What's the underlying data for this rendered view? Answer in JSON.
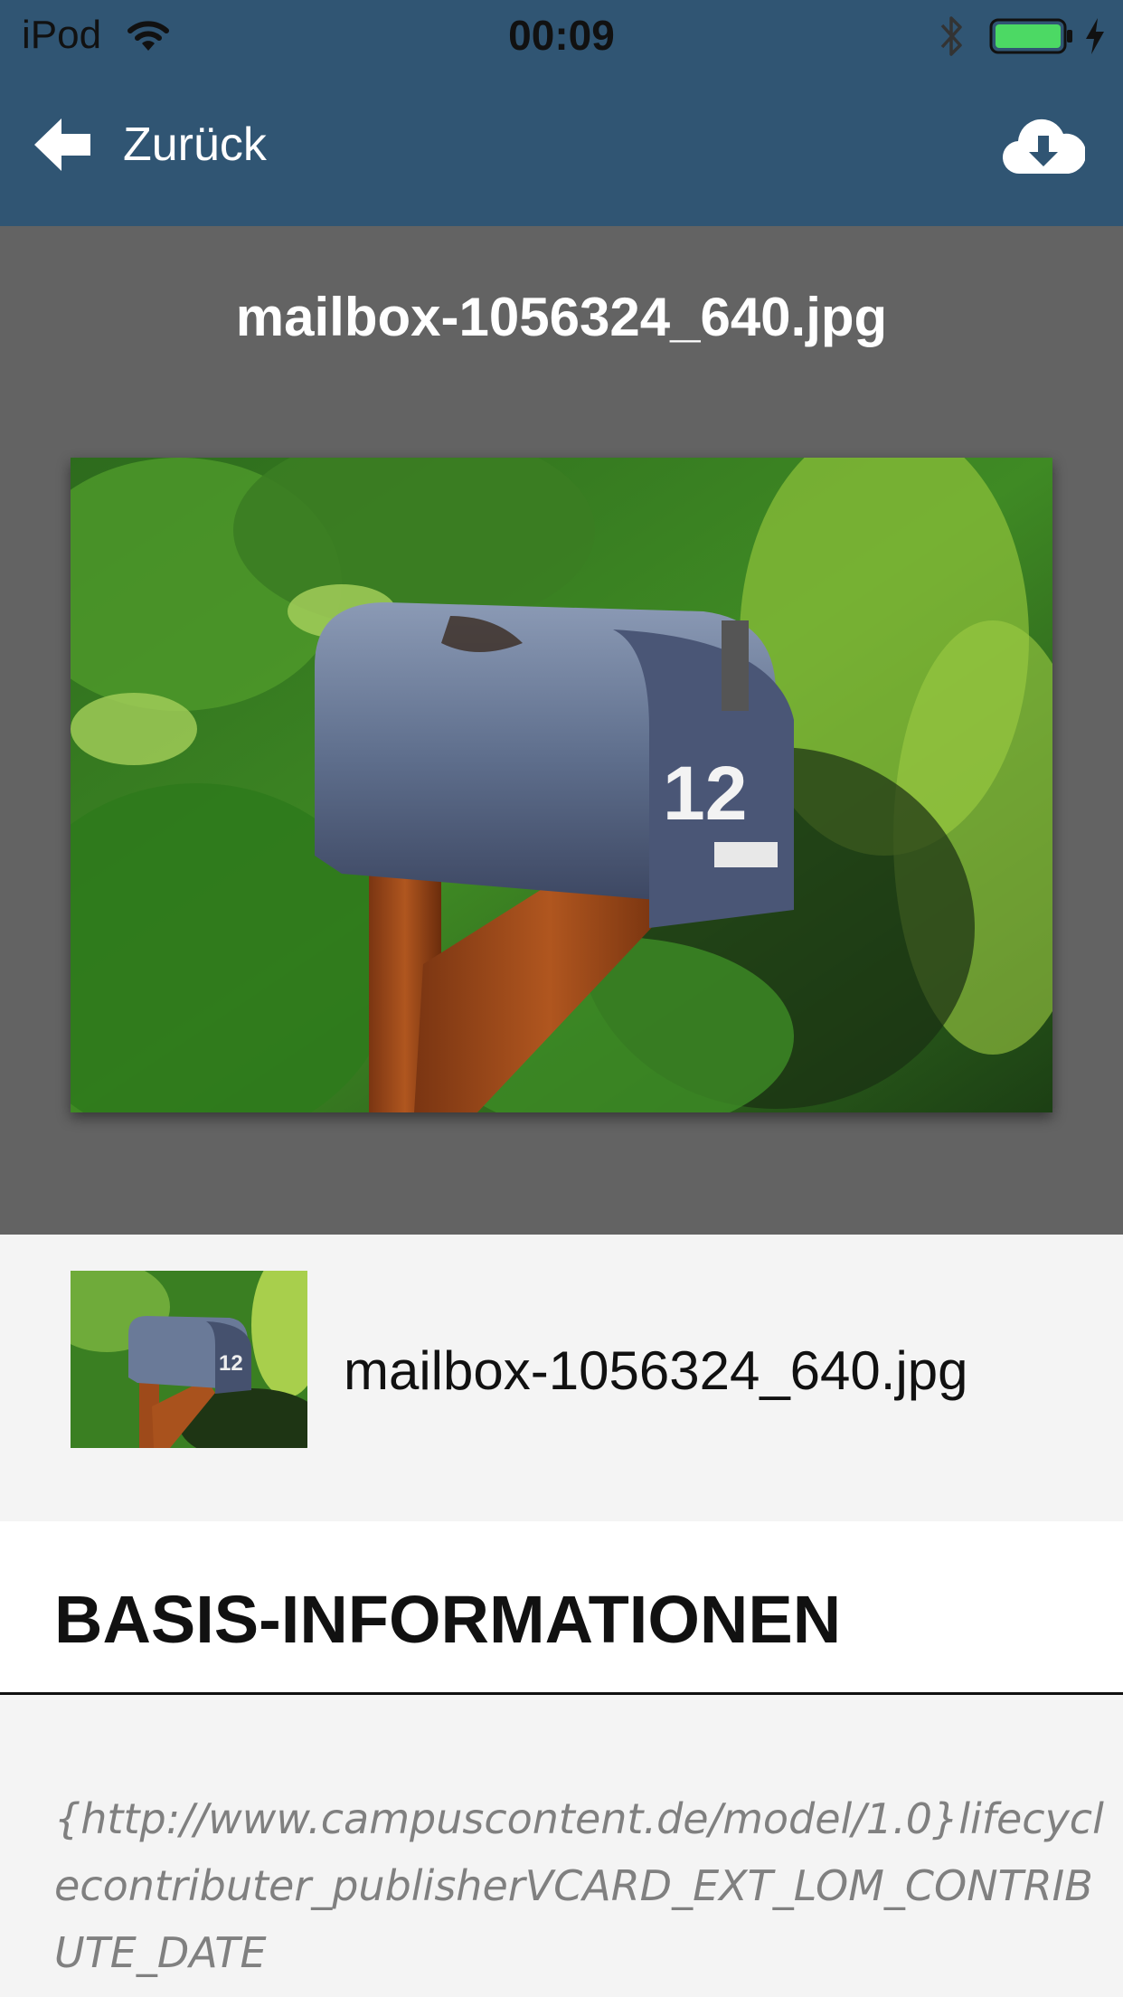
{
  "status_bar": {
    "carrier": "iPod",
    "time": "00:09"
  },
  "nav": {
    "back_label": "Zurück",
    "back_icon": "arrow-left-icon",
    "action_icon": "cloud-download-icon"
  },
  "preview": {
    "title": "mailbox-1056324_640.jpg",
    "mailbox_number": "12"
  },
  "file": {
    "name": "mailbox-1056324_640.jpg",
    "thumb_number": "12"
  },
  "section": {
    "title": "BASIS-INFORMATIONEN"
  },
  "property": {
    "key": "{http://www.campuscontent.de/model/1.0}lifecyclecontributer_publisherVCARD_EXT_LOM_CONTRIBUTE_DATE"
  },
  "colors": {
    "header_bg": "#305573",
    "preview_bg": "#636363",
    "battery": "#4cd964"
  }
}
